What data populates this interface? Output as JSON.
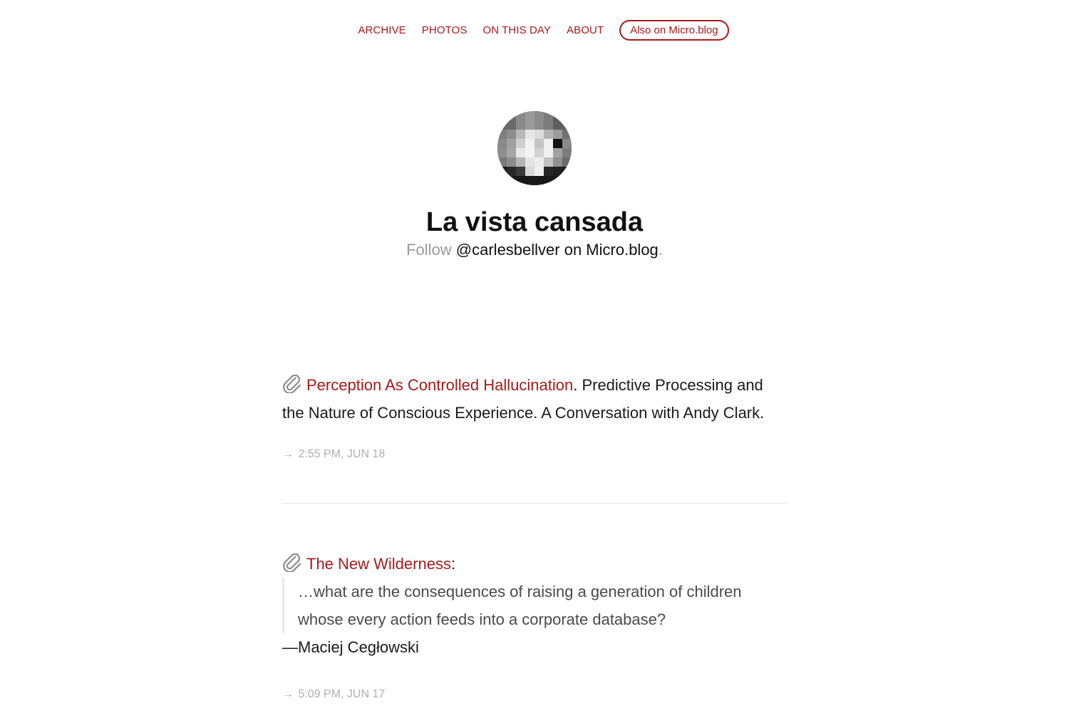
{
  "nav": {
    "items": [
      "ARCHIVE",
      "PHOTOS",
      "ON THIS DAY",
      "ABOUT"
    ],
    "pill_label": "Also on Micro.blog"
  },
  "header": {
    "title": "La vista cansada",
    "follow_word": "Follow",
    "handle_text": "@carlesbellver on Micro.blog",
    "trailing_dot": "."
  },
  "posts": [
    {
      "link_text": "Perception As Controlled Hallucination",
      "body_text": ". Predictive Processing and the Nature of Conscious Experience. A Conversation with Andy Clark.",
      "meta_arrow": "→",
      "meta_time": "2:55 PM, JUN 18"
    },
    {
      "link_text": "The New Wilderness",
      "colon": ":",
      "quote_text": "…what are the consequences of raising a generation of children whose every action feeds into a corporate database?",
      "author_text": "—Maciej Cegłowski",
      "meta_arrow": "→",
      "meta_time": "5:09 PM, JUN 17"
    }
  ],
  "colors": {
    "accent": "#a51b1b",
    "muted": "#9a9a9a",
    "meta": "#b0b0b0"
  }
}
